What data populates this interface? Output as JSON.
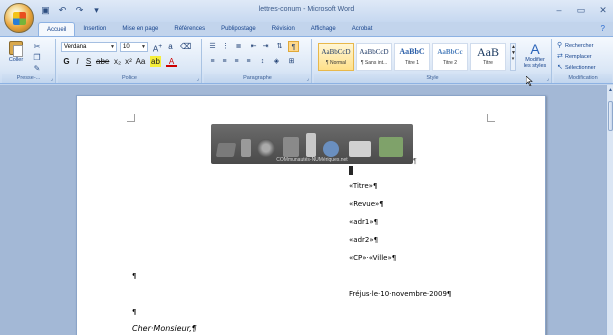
{
  "titlebar": {
    "title": "lettres-conum - Microsoft Word",
    "qat": [
      {
        "icon": "save-icon",
        "glyph": "▣"
      },
      {
        "icon": "undo-icon",
        "glyph": "↶"
      },
      {
        "icon": "redo-icon",
        "glyph": "↷"
      },
      {
        "icon": "customize-icon",
        "glyph": "▾"
      }
    ],
    "controls": {
      "minimize": "–",
      "maximize": "▭",
      "close": "✕"
    }
  },
  "tabs": [
    "Accueil",
    "Insertion",
    "Mise en page",
    "Références",
    "Publipostage",
    "Révision",
    "Affichage",
    "Acrobat"
  ],
  "active_tab": "Accueil",
  "ribbon": {
    "clipboard": {
      "label": "Presse-...",
      "paste": "Coller"
    },
    "font": {
      "label": "Police",
      "font_name": "Verdana",
      "font_size": "10"
    },
    "paragraph": {
      "label": "Paragraphe"
    },
    "style": {
      "label": "Style",
      "styles": [
        {
          "sample": "AaBbCcD",
          "name": "¶ Normal",
          "selected": true
        },
        {
          "sample": "AaBbCcD",
          "name": "¶ Sans int...",
          "selected": false
        },
        {
          "sample": "AaBbC",
          "name": "Titre 1",
          "selected": false
        },
        {
          "sample": "AaBbCc",
          "name": "Titre 2",
          "selected": false
        },
        {
          "sample": "AaB",
          "name": "Titre",
          "selected": false
        }
      ],
      "change_styles_line1": "Modifier",
      "change_styles_line2": "les styles"
    },
    "editing": {
      "label": "Modification",
      "find": "Rechercher",
      "replace": "Remplacer",
      "select": "Sélectionner"
    }
  },
  "banner": {
    "text": "COMmunautés-NUMériques.net"
  },
  "document": {
    "pilcrow": "¶",
    "merge_fields": [
      "«Titre»¶",
      "«Revue»¶",
      "«adr1»¶",
      "«adr2»¶",
      "«CP»·«Ville»¶"
    ],
    "empty_para_1": "¶",
    "date_line": "Fréjus·le·10·novembre·2009¶",
    "empty_para_2": "¶",
    "greeting": "Cher·Monsieur,¶"
  }
}
